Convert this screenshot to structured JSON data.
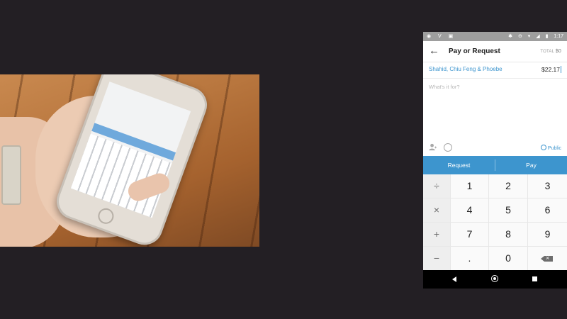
{
  "photo": {
    "alt_subject": "hand-holding-phone-photo"
  },
  "status_bar": {
    "left_icons": [
      "spotify-icon",
      "venmo-icon",
      "image-icon"
    ],
    "right_icons": [
      "bluetooth-icon",
      "minus-circle-icon",
      "wifi-icon",
      "signal-icon",
      "battery-icon"
    ],
    "left_glyphs": "◉ V ▣",
    "right_glyphs": "✱ ⊖ ▾ ◢ ▮",
    "time": "1:17"
  },
  "header": {
    "back_icon": "arrow-back-icon",
    "back_glyph": "←",
    "title": "Pay or Request",
    "total_label": "TOTAL",
    "total_value": "$0"
  },
  "payment": {
    "recipients": "Shahid, Chiu Feng & Phoebe",
    "amount": "$22.17",
    "note_placeholder": "What's it for?"
  },
  "options": {
    "person_icon": "person-add-icon",
    "emoji_icon": "emoji-icon",
    "privacy_icon": "globe-icon",
    "privacy_label": "Public"
  },
  "actions": {
    "request_label": "Request",
    "pay_label": "Pay"
  },
  "keypad": {
    "operators": [
      "÷",
      "×",
      "+",
      "−"
    ],
    "rows": [
      [
        "1",
        "2",
        "3"
      ],
      [
        "4",
        "5",
        "6"
      ],
      [
        "7",
        "8",
        "9"
      ],
      [
        ".",
        "0"
      ]
    ],
    "backspace_icon": "backspace-icon"
  },
  "nav_bar": {
    "icons": [
      "nav-back-icon",
      "nav-home-icon",
      "nav-recents-icon"
    ]
  },
  "colors": {
    "accent": "#3d95ce",
    "background": "#231f24",
    "status_bar": "#9e9e9e",
    "nav_bar": "#000000"
  }
}
